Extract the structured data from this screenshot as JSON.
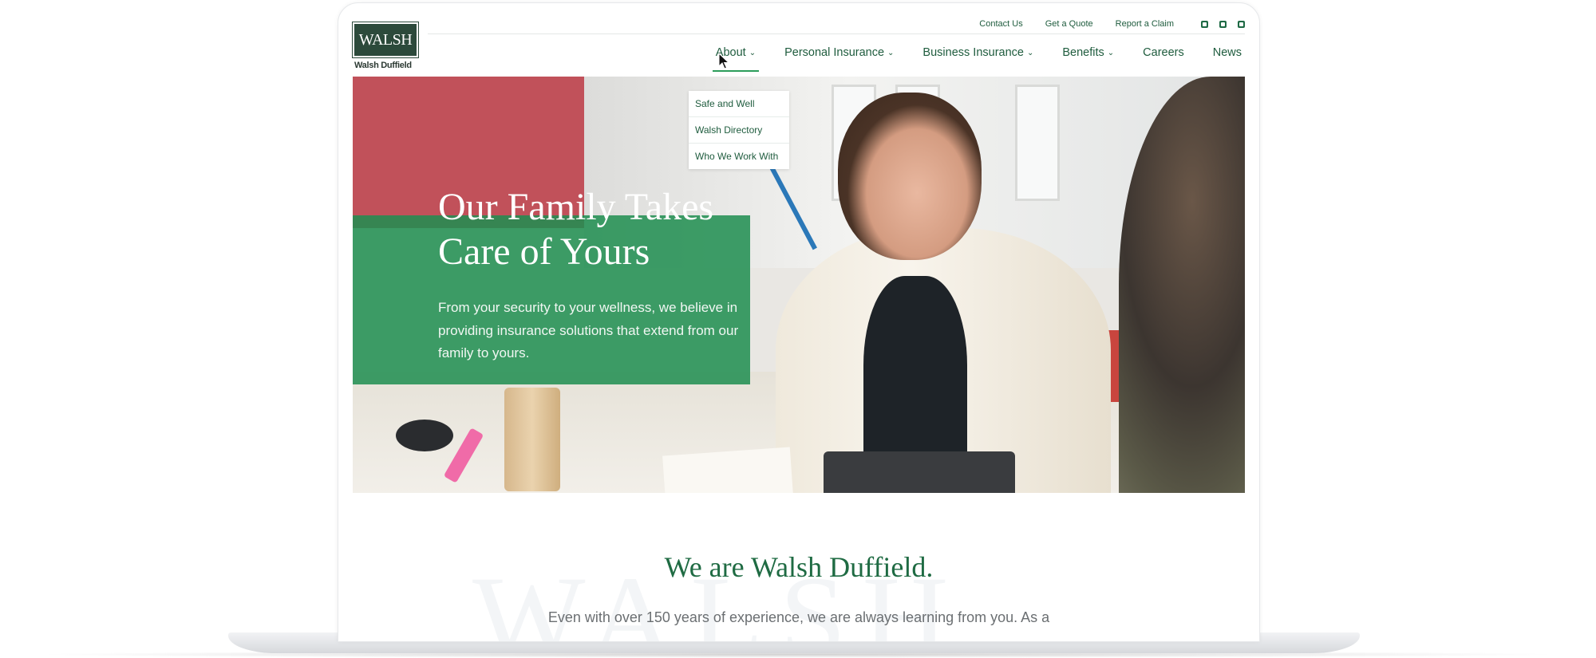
{
  "logo": {
    "mark": "WALSH",
    "subtitle": "Walsh Duffield"
  },
  "utility_nav": [
    "Contact Us",
    "Get a Quote",
    "Report a Claim"
  ],
  "social_icons": [
    "facebook-icon",
    "linkedin-icon",
    "twitter-icon"
  ],
  "main_nav": [
    {
      "label": "About",
      "dropdown": true,
      "active": true
    },
    {
      "label": "Personal Insurance",
      "dropdown": true
    },
    {
      "label": "Business Insurance",
      "dropdown": true
    },
    {
      "label": "Benefits",
      "dropdown": true
    },
    {
      "label": "Careers",
      "dropdown": false
    },
    {
      "label": "News",
      "dropdown": false
    }
  ],
  "about_dropdown": [
    "Safe and Well",
    "Walsh Directory",
    "Who We Work With"
  ],
  "hero": {
    "title": "Our Family Takes Care of Yours",
    "text": "From your security to your wellness, we believe in providing insurance solutions that extend from our family to yours."
  },
  "intro": {
    "watermark": "WALSH",
    "title": "We are Walsh Duffield.",
    "text": "Even with over 150 years of experience, we are always learning from you. As a"
  },
  "colors": {
    "brand_green": "#1f6b43",
    "hero_green": "#208e50",
    "logo_bg": "#2c4a3b"
  }
}
